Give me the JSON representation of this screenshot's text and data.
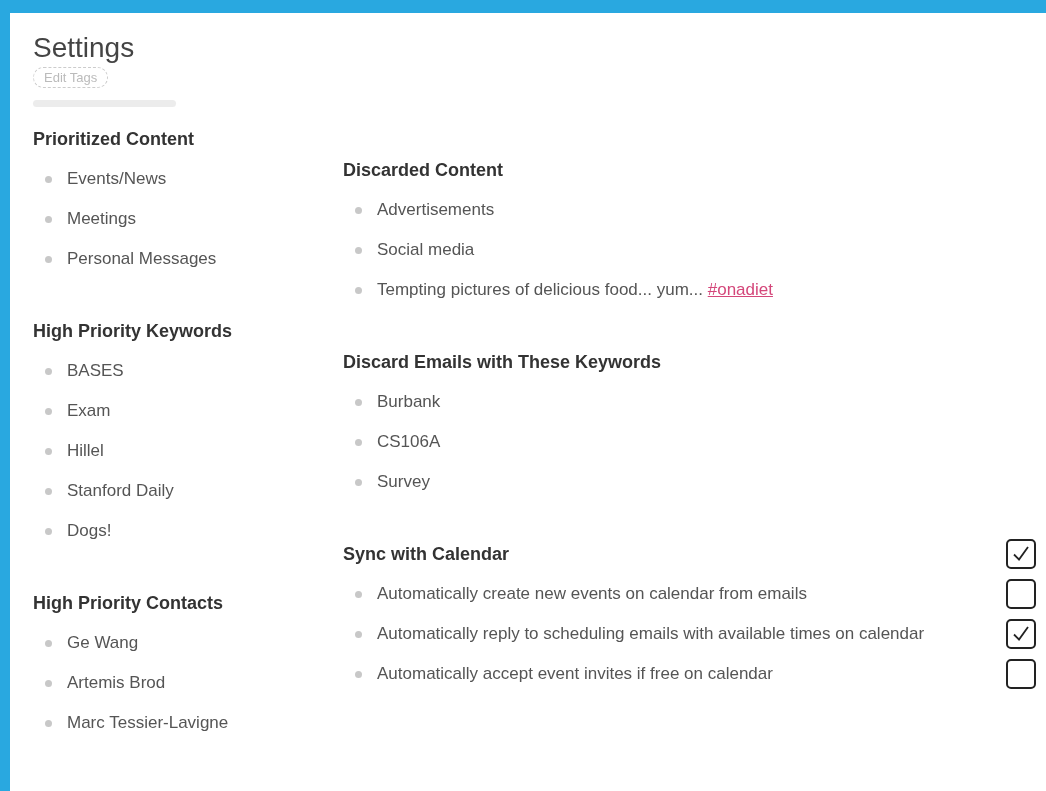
{
  "title": "Settings",
  "edit_button": "Edit Tags",
  "left_sections": [
    {
      "heading": "Prioritized Content",
      "items": [
        {
          "text": "Events/News"
        },
        {
          "text": "Meetings"
        },
        {
          "text": "Personal Messages"
        }
      ]
    },
    {
      "heading": "High Priority Keywords",
      "items": [
        {
          "text": "BASES"
        },
        {
          "text": "Exam"
        },
        {
          "text": "Hillel"
        },
        {
          "text": "Stanford Daily"
        },
        {
          "text": "Dogs!"
        }
      ]
    },
    {
      "heading": "High Priority Contacts",
      "items": [
        {
          "text": "Ge Wang"
        },
        {
          "text": "Artemis Brod"
        },
        {
          "text": "Marc Tessier-Lavigne"
        }
      ]
    }
  ],
  "right_sections": [
    {
      "heading": "Discarded Content",
      "items": [
        {
          "text": "Advertisements"
        },
        {
          "text": "Social media"
        },
        {
          "text": "Tempting pictures of delicious food... yum... ",
          "tag": "#onadiet"
        }
      ]
    },
    {
      "heading": "Discard Emails with These Keywords",
      "items": [
        {
          "text": "Burbank"
        },
        {
          "text": "CS106A"
        },
        {
          "text": "Survey"
        }
      ]
    },
    {
      "heading": "Sync with Calendar",
      "checked": true,
      "items": [
        {
          "text": "Automatically create new events on calendar from emails",
          "checked": false
        },
        {
          "text": "Automatically reply to scheduling emails with available times on calendar",
          "checked": true
        },
        {
          "text": "Automatically accept event invites if free on calendar",
          "checked": false
        }
      ]
    }
  ]
}
